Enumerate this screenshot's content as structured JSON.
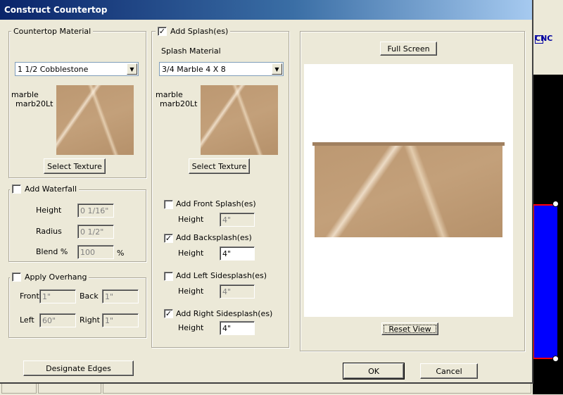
{
  "window": {
    "title": "Construct Countertop"
  },
  "background_app": {
    "toolbar_text": "CNC"
  },
  "countertop": {
    "group_title": "Countertop Material",
    "material_selected": "1 1/2 Cobblestone",
    "texture_type": "marble",
    "texture_name": "marb20Lt",
    "select_texture_label": "Select Texture"
  },
  "waterfall": {
    "label": "Add Waterfall",
    "checked": false,
    "height_label": "Height",
    "height_value": "0 1/16\"",
    "radius_label": "Radius",
    "radius_value": "0 1/2\"",
    "blend_label": "Blend %",
    "blend_value": "100",
    "blend_unit": "%"
  },
  "overhang": {
    "label": "Apply Overhang",
    "checked": false,
    "front_label": "Front",
    "front_value": "1\"",
    "back_label": "Back",
    "back_value": "1\"",
    "left_label": "Left",
    "left_value": "60\"",
    "right_label": "Right",
    "right_value": "1\""
  },
  "designate_edges_label": "Designate Edges",
  "splash": {
    "label": "Add Splash(es)",
    "checked": true,
    "material_label": "Splash Material",
    "material_selected": "3/4 Marble 4 X 8",
    "texture_type": "marble",
    "texture_name": "marb20Lt",
    "select_texture_label": "Select Texture",
    "height_label": "Height",
    "front": {
      "label": "Add Front Splash(es)",
      "checked": false,
      "height": "4\""
    },
    "back": {
      "label": "Add Backsplash(es)",
      "checked": true,
      "height": "4\""
    },
    "left": {
      "label": "Add Left Sidesplash(es)",
      "checked": false,
      "height": "4\""
    },
    "right": {
      "label": "Add Right Sidesplash(es)",
      "checked": true,
      "height": "4\""
    }
  },
  "preview": {
    "full_screen_label": "Full Screen",
    "reset_view_label": "Reset View"
  },
  "ok_label": "OK",
  "cancel_label": "Cancel",
  "icons": {
    "check": "✓",
    "dropdown": "▼"
  }
}
